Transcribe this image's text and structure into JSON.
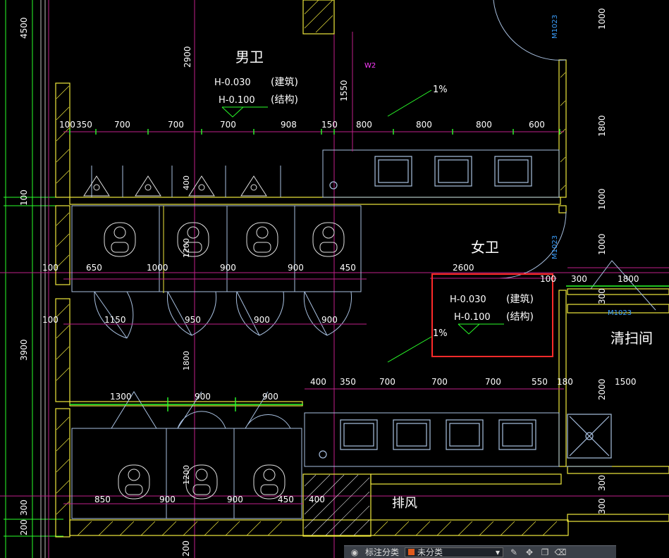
{
  "rooms": {
    "men": "男卫",
    "women": "女卫",
    "cleaning": "清扫间",
    "exhaust": "排风"
  },
  "elevations": {
    "men_arch": "H-0.030",
    "men_arch_note": "(建筑)",
    "men_struct": "H-0.100",
    "men_struct_note": "(结构)",
    "women_arch": "H-0.030",
    "women_arch_note": "(建筑)",
    "women_struct": "H-0.100",
    "women_struct_note": "(结构)"
  },
  "slopes": {
    "s1": "1%",
    "s2": "1%"
  },
  "door_tags": {
    "d1": "M1023",
    "d2": "M1023",
    "d3": "M1023",
    "w2": "W2"
  },
  "dims": {
    "top_row": [
      "100",
      "350",
      "700",
      "700",
      "700",
      "908",
      "150",
      "800",
      "800",
      "800",
      "600"
    ],
    "left_col": [
      "4500",
      "100",
      "100",
      "3900",
      "300",
      "200"
    ],
    "stall_row_upper": [
      "100",
      "650",
      "1000",
      "900",
      "900",
      "450"
    ],
    "door_row_upper": [
      "100",
      "1150",
      "950",
      "900",
      "900"
    ],
    "mid_vertical": [
      "2900",
      "1550",
      "400",
      "1200",
      "1800"
    ],
    "women_top": [
      "2600",
      "100",
      "300",
      "1800"
    ],
    "sink_row": [
      "400",
      "350",
      "700",
      "700",
      "700",
      "550",
      "180",
      "1500"
    ],
    "lower_doors": [
      "1300",
      "900",
      "900"
    ],
    "bottom_row": [
      "850",
      "900",
      "900",
      "450",
      "400"
    ],
    "right_col": [
      "1000",
      "1800",
      "1000",
      "1000",
      "300",
      "300",
      "2000",
      "300",
      "300"
    ],
    "lower_vertical": [
      "1200",
      "200"
    ]
  },
  "toolbar": {
    "label": "标注分类",
    "selected": "未分类",
    "swatch_color": "#e05a1c"
  },
  "highlight_color": "#ff2a2a"
}
